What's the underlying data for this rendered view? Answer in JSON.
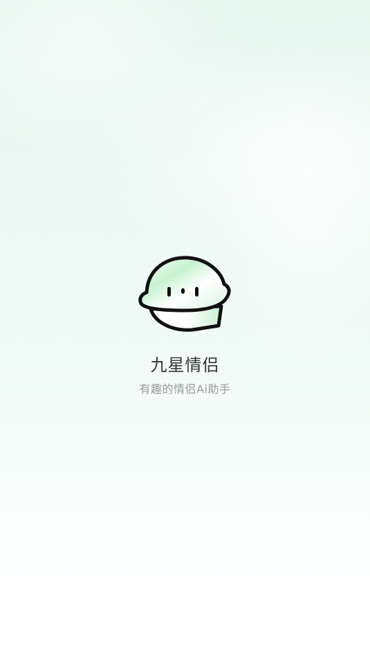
{
  "app": {
    "name": "九星情侣",
    "tagline": "有趣的情侣Ai助手",
    "logo_icon": "helmet-mascot-icon"
  },
  "colors": {
    "title": "#333333",
    "subtitle": "#9a9a9a",
    "accent_green": "#bff3c9",
    "background_mint": "#e7f7f0"
  }
}
